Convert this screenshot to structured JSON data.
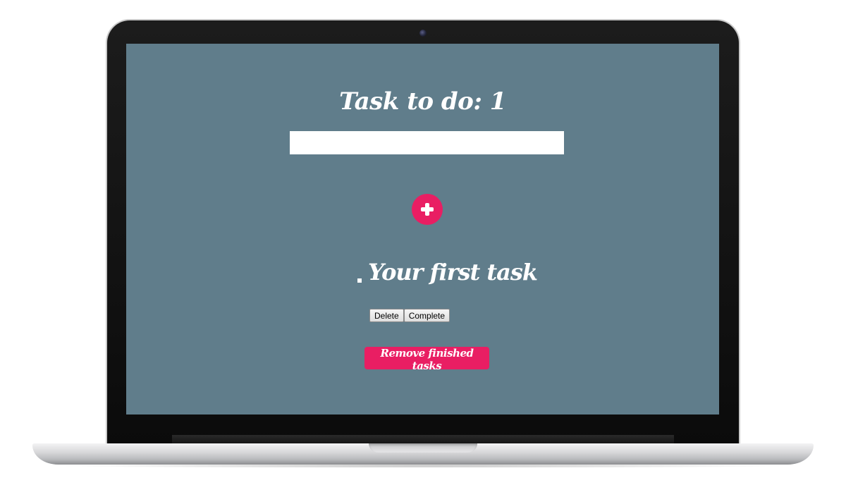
{
  "app": {
    "heading_prefix": "Task to do: ",
    "task_count": "1"
  },
  "input": {
    "value": "",
    "placeholder": ""
  },
  "add_button": {
    "icon": "plus-icon"
  },
  "tasks": [
    {
      "text": "Your first task",
      "delete_label": "Delete",
      "complete_label": "Complete"
    }
  ],
  "remove_finished_label": "Remove finished tasks",
  "colors": {
    "screen_background": "#607d8b",
    "accent": "#e91e63",
    "text": "#ffffff"
  }
}
